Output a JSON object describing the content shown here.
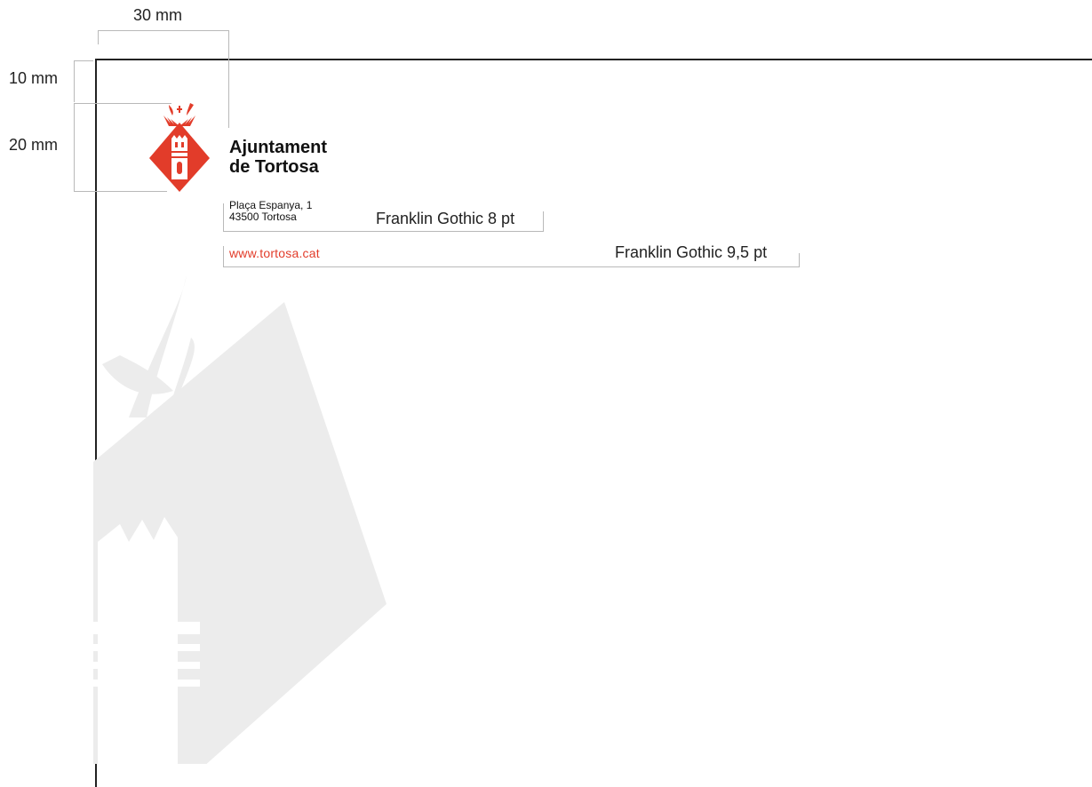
{
  "dimensions": {
    "width_label": "30 mm",
    "top_label": "10 mm",
    "logo_label": "20 mm"
  },
  "brand": {
    "line1": "Ajuntament",
    "line2": "de Tortosa"
  },
  "address": {
    "line1": "Plaça Espanya, 1",
    "line2": "43500 Tortosa",
    "spec": "Franklin Gothic 8 pt"
  },
  "website": {
    "url": "www.tortosa.cat",
    "spec": "Franklin Gothic 9,5 pt"
  },
  "colors": {
    "brand_red": "#e23c2a",
    "watermark_gray": "#ececec",
    "guide_gray": "#b9b9b9"
  }
}
